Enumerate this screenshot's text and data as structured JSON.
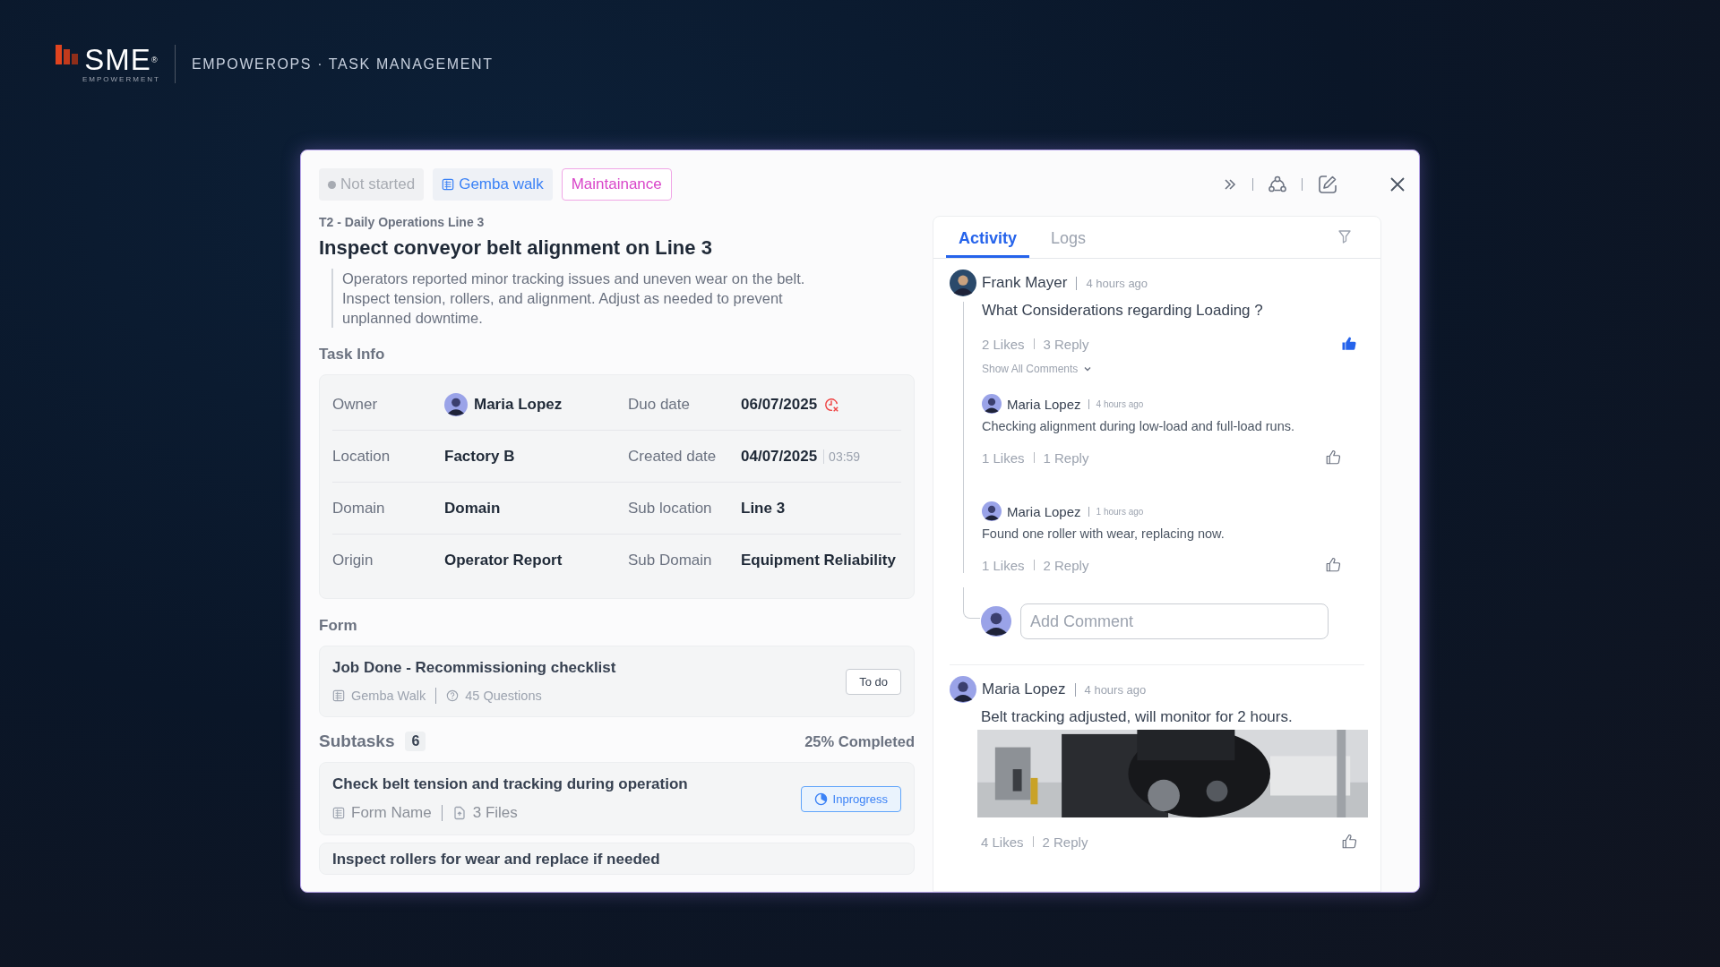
{
  "header": {
    "brand": "SME",
    "brand_mark": "®",
    "brand_sub": "EMPOWERMENT",
    "title": "EMPOWEROPS · TASK MANAGEMENT"
  },
  "tags": [
    {
      "kind": "status",
      "label": "Not started"
    },
    {
      "kind": "form",
      "label": "Gemba walk"
    },
    {
      "kind": "category",
      "label": "Maintainance"
    }
  ],
  "breadcrumb": "T2 - Daily Operations Line 3",
  "title": "Inspect conveyor belt alignment on Line 3",
  "description": "Operators reported minor tracking issues and uneven wear on the belt. Inspect tension, rollers, and alignment. Adjust as needed to prevent unplanned downtime.",
  "task_info": {
    "heading": "Task Info",
    "rows": [
      {
        "cells": [
          {
            "label": "Owner",
            "value": "Maria Lopez",
            "kind": "person"
          },
          {
            "label": "Duo date",
            "value": "06/07/2025",
            "kind": "date",
            "overdue": true
          }
        ]
      },
      {
        "cells": [
          {
            "label": "Location",
            "value": "Factory B",
            "kind": "text"
          },
          {
            "label": "Created date",
            "value": "04/07/2025",
            "kind": "date",
            "time": "03:59"
          }
        ]
      },
      {
        "cells": [
          {
            "label": "Domain",
            "value": "Domain",
            "kind": "text"
          },
          {
            "label": "Sub location",
            "value": "Line 3",
            "kind": "text"
          }
        ]
      },
      {
        "cells": [
          {
            "label": "Origin",
            "value": "Operator Report",
            "kind": "text"
          },
          {
            "label": "Sub Domain",
            "value": "Equipment Reliability",
            "kind": "text"
          }
        ]
      }
    ]
  },
  "form": {
    "heading": "Form",
    "title": "Job Done - Recommissioning checklist",
    "form_name": "Gemba Walk",
    "questions": "45 Questions",
    "action": "To do"
  },
  "subtasks": {
    "heading": "Subtasks",
    "count": "6",
    "progress": "25% Completed",
    "items": [
      {
        "title": "Check belt tension and tracking during operation",
        "form_name": "Form Name",
        "files": "3 Files",
        "status": "Inprogress"
      },
      {
        "title": "Inspect rollers for wear and replace if needed"
      }
    ]
  },
  "activity": {
    "tabs": [
      {
        "label": "Activity",
        "selected": true
      },
      {
        "label": "Logs",
        "selected": false
      }
    ],
    "threads": [
      {
        "author": "Frank Mayer",
        "time": "4 hours ago",
        "text": "What Considerations regarding Loading ?",
        "likes": "2 Likes",
        "replies": "3 Reply",
        "liked": true,
        "show_all": "Show All Comments",
        "comments": [
          {
            "author": "Maria Lopez",
            "time": "4 hours ago",
            "text": "Checking alignment during low-load and full-load runs.",
            "likes": "1 Likes",
            "replies": "1 Reply",
            "liked": false
          },
          {
            "author": "Maria Lopez",
            "time": "1 hours ago",
            "text": "Found one roller with wear, replacing now.",
            "likes": "1 Likes",
            "replies": "2 Reply",
            "liked": false
          }
        ],
        "comment_placeholder": "Add Comment"
      },
      {
        "author": "Maria Lopez",
        "time": "4 hours ago",
        "text": "Belt tracking adjusted, will monitor for 2 hours.",
        "likes": "4 Likes",
        "replies": "2 Reply",
        "liked": false
      }
    ]
  }
}
